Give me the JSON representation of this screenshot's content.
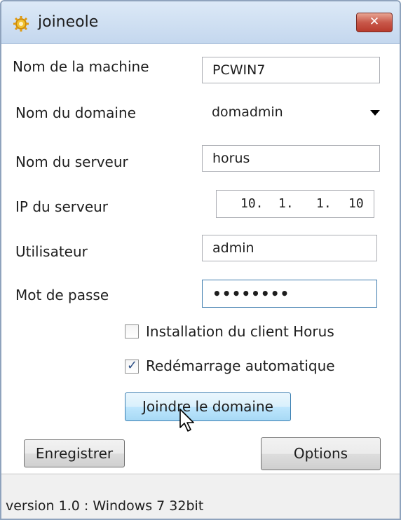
{
  "window": {
    "title": "joineole",
    "close_label": "✕"
  },
  "form": {
    "machine_name_label": "Nom de la machine",
    "machine_name_value": "PCWIN7",
    "domain_label": "Nom du domaine",
    "domain_value": "domadmin",
    "server_name_label": "Nom du serveur",
    "server_name_value": "horus",
    "server_ip_label": "IP du serveur",
    "server_ip_octets": [
      "10.",
      "1.",
      "1.",
      "10"
    ],
    "user_label": "Utilisateur",
    "user_value": "admin",
    "password_label": "Mot de passe",
    "password_value": "••••••••"
  },
  "options": {
    "install_client_label": "Installation du client Horus",
    "install_client_checked": false,
    "auto_reboot_label": "Redémarrage automatique",
    "auto_reboot_checked": true
  },
  "buttons": {
    "join_label": "Joindre le domaine",
    "save_label": "Enregistrer",
    "options_label": "Options"
  },
  "status": {
    "version_text": "version 1.0 : Windows 7 32bit"
  }
}
